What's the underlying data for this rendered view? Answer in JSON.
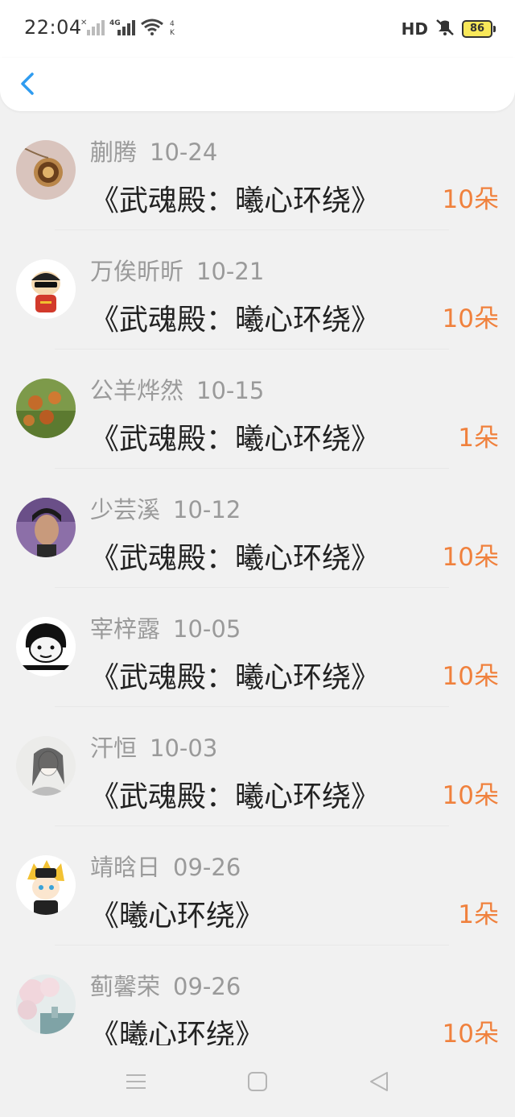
{
  "status_bar": {
    "time": "22:04",
    "hd_label": "HD",
    "battery_level": "86",
    "icons": [
      "signal-x-icon",
      "signal-4g-icon",
      "wifi-icon",
      "speed-4k-icon",
      "mute-icon",
      "battery-icon"
    ]
  },
  "header": {
    "back_icon": "chevron-left-icon"
  },
  "rows": [
    {
      "name": "蒯腾",
      "date": "10-24",
      "title": "《武魂殿：曦心环绕》",
      "count": "10朵",
      "avatar": "pocket-watch"
    },
    {
      "name": "万俟昕昕",
      "date": "10-21",
      "title": "《武魂殿：曦心环绕》",
      "count": "10朵",
      "avatar": "cartoon-kid-sunglasses"
    },
    {
      "name": "公羊烨然",
      "date": "10-15",
      "title": "《武魂殿：曦心环绕》",
      "count": "1朵",
      "avatar": "green-fruit"
    },
    {
      "name": "少芸溪",
      "date": "10-12",
      "title": "《武魂殿：曦心环绕》",
      "count": "10朵",
      "avatar": "man-portrait"
    },
    {
      "name": "宰梓露",
      "date": "10-05",
      "title": "《武魂殿：曦心环绕》",
      "count": "10朵",
      "avatar": "meme-face"
    },
    {
      "name": "汗恒",
      "date": "10-03",
      "title": "《武魂殿：曦心环绕》",
      "count": "10朵",
      "avatar": "ink-painting-character"
    },
    {
      "name": "靖晗日",
      "date": "09-26",
      "title": "《曦心环绕》",
      "count": "1朵",
      "avatar": "anime-character"
    },
    {
      "name": "蓟馨荣",
      "date": "09-26",
      "title": "《曦心环绕》",
      "count": "10朵",
      "avatar": "cherry-blossom-scene"
    }
  ],
  "nav_bar": {
    "icons": [
      "menu-icon",
      "home-square-icon",
      "back-triangle-icon"
    ]
  },
  "colors": {
    "accent_blue": "#2f9cf0",
    "count_orange": "#f0813d",
    "name_gray": "#9a9a9a",
    "title_dark": "#222222"
  }
}
